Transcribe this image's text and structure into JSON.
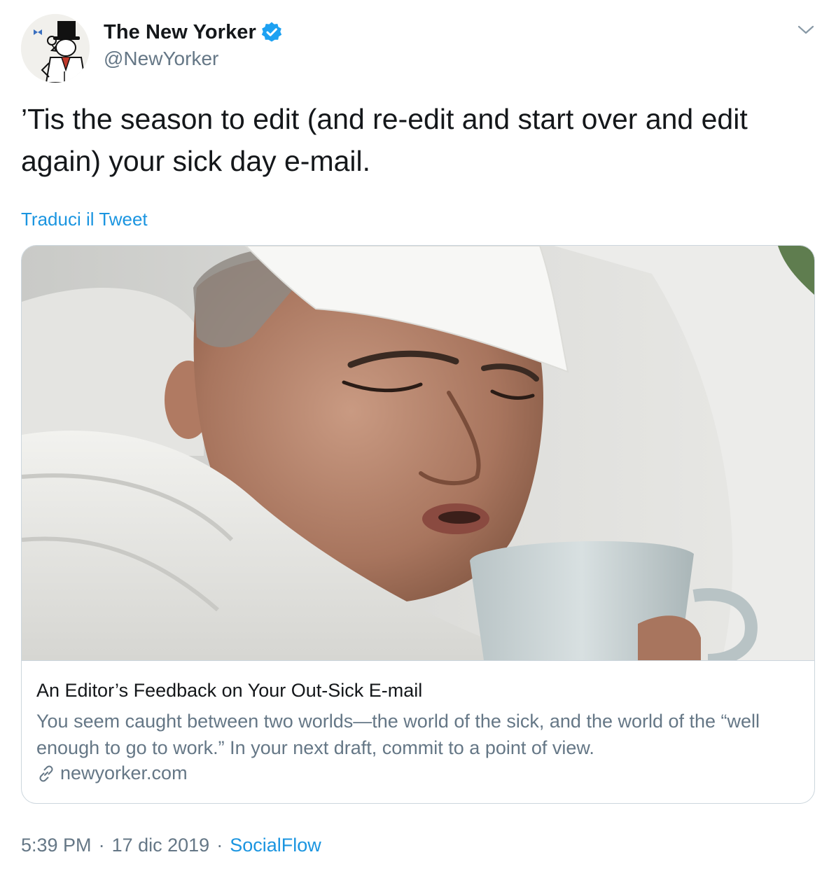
{
  "author": {
    "name": "The New Yorker",
    "handle": "@NewYorker",
    "verified": true,
    "avatar_icon": "eustace-tilley-icon"
  },
  "tweet": {
    "text": "’Tis the season to edit (and re-edit and start over and edit again) your sick day e-mail.",
    "translate_label": "Traduci il Tweet"
  },
  "card": {
    "image_alt": "",
    "title": "An Editor’s Feedback on Your Out-Sick E-mail",
    "description": "You seem caught between two worlds—the world of the sick, and the world of the “well enough to go to work.” In your next draft, commit to a point of view.",
    "domain": "newyorker.com",
    "domain_icon": "link-icon"
  },
  "meta": {
    "time": "5:39 PM",
    "date": "17 dic 2019",
    "separator": "·",
    "source": "SocialFlow"
  },
  "colors": {
    "link_blue": "#1b95e0",
    "secondary_text": "#657786",
    "primary_text": "#14171a",
    "border": "#ccd6dd",
    "verified_blue": "#1da1f2"
  }
}
